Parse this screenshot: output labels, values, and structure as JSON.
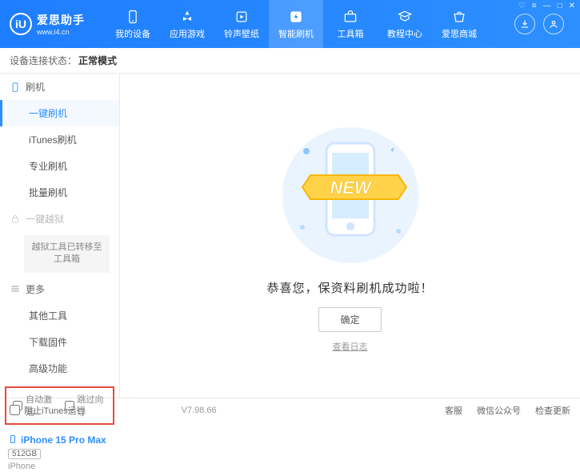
{
  "brand": {
    "title": "爱思助手",
    "subtitle": "www.i4.cn",
    "logo_letter": "iU"
  },
  "nav": {
    "items": [
      {
        "label": "我的设备"
      },
      {
        "label": "应用游戏"
      },
      {
        "label": "铃声壁纸"
      },
      {
        "label": "智能刷机"
      },
      {
        "label": "工具箱"
      },
      {
        "label": "教程中心"
      },
      {
        "label": "爱思商城"
      }
    ]
  },
  "status": {
    "label": "设备连接状态：",
    "value": "正常模式"
  },
  "sidebar": {
    "group1": {
      "title": "刷机",
      "items": [
        "一键刷机",
        "iTunes刷机",
        "专业刷机",
        "批量刷机"
      ]
    },
    "group2": {
      "title": "一键越狱",
      "note": "越狱工具已转移至工具箱"
    },
    "group3": {
      "title": "更多",
      "items": [
        "其他工具",
        "下载固件",
        "高级功能"
      ]
    },
    "checks": {
      "auto_activate": "自动激活",
      "skip_guide": "跳过向导"
    }
  },
  "device": {
    "name": "iPhone 15 Pro Max",
    "storage": "512GB",
    "type": "iPhone"
  },
  "main": {
    "message": "恭喜您，保资料刷机成功啦！",
    "ok_label": "确定",
    "log_link": "查看日志",
    "ribbon": "NEW"
  },
  "footer": {
    "block_itunes": "阻止iTunes运行",
    "version": "V7.98.66",
    "links": [
      "客服",
      "微信公众号",
      "检查更新"
    ]
  }
}
